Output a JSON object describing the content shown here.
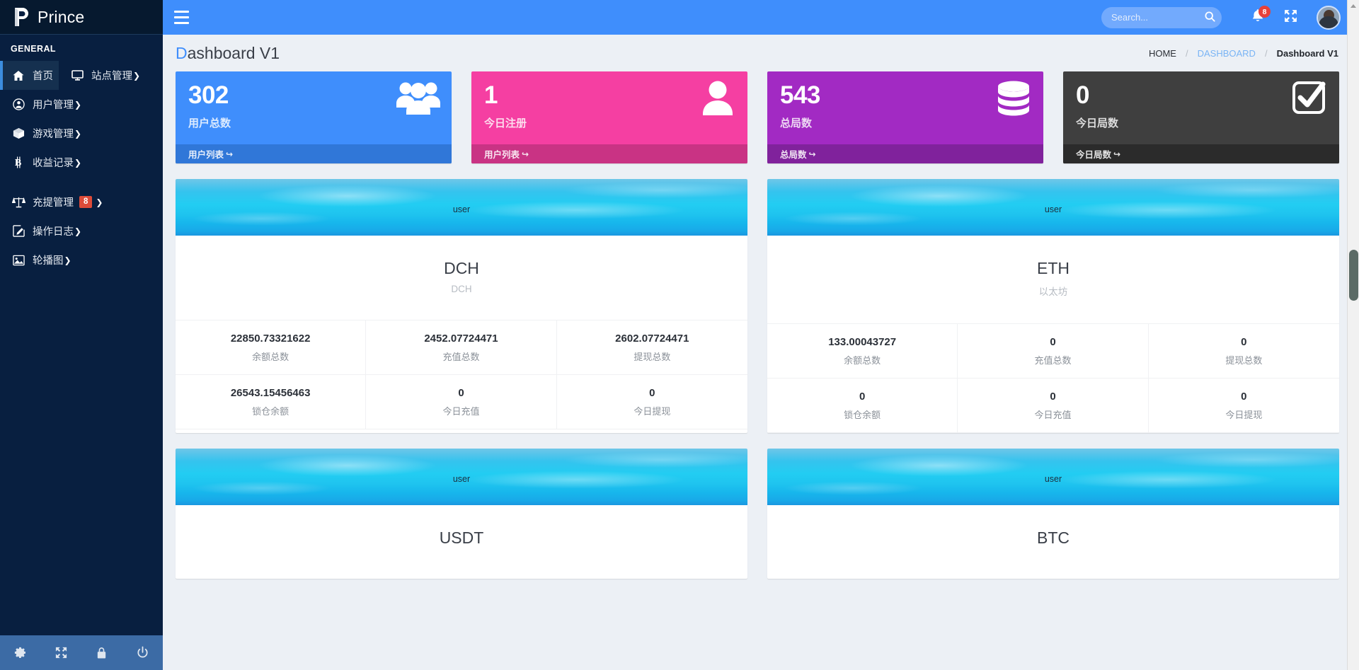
{
  "brand": {
    "name": "Prince",
    "logo_icon": "prince-logo-icon"
  },
  "sidebar": {
    "section_label": "GENERAL",
    "items": [
      {
        "label": "首页",
        "icon": "home-icon",
        "active": true
      },
      {
        "label": "站点管理",
        "icon": "monitor-icon",
        "caret": "❯"
      },
      {
        "label": "用户管理",
        "icon": "user-circle-icon",
        "caret": "❯"
      },
      {
        "label": "游戏管理",
        "icon": "cube-icon",
        "caret": "❯"
      },
      {
        "label": "收益记录",
        "icon": "bitcoin-icon",
        "caret": "❯"
      },
      {
        "label": "充提管理",
        "icon": "balance-scale-icon",
        "badge": "8",
        "caret": "❯"
      },
      {
        "label": "操作日志",
        "icon": "edit-square-icon",
        "caret": "❯"
      },
      {
        "label": "轮播图",
        "icon": "image-icon",
        "caret": "❯"
      }
    ],
    "footer_icons": [
      {
        "name": "gear-icon"
      },
      {
        "name": "expand-arrows-icon"
      },
      {
        "name": "lock-icon"
      },
      {
        "name": "power-off-icon"
      }
    ]
  },
  "topbar": {
    "menu_toggle_icon": "hamburger-icon",
    "search": {
      "placeholder": "Search...",
      "value": "",
      "icon": "search-icon"
    },
    "notifications": {
      "icon": "bell-icon",
      "badge": "8"
    },
    "fullscreen_icon": "expand-arrows-icon",
    "avatar_icon": "user-avatar"
  },
  "page": {
    "title_first": "D",
    "title_rest": "ashboard V1",
    "breadcrumb": [
      {
        "label": "HOME",
        "type": "plain"
      },
      {
        "label": "DASHBOARD",
        "type": "link"
      },
      {
        "label": "Dashboard V1",
        "type": "current"
      }
    ],
    "breadcrumb_sep": "/"
  },
  "stat_cards": [
    {
      "value": "302",
      "label": "用户总数",
      "footer": "用户列表",
      "footer_icon": "↪",
      "icon": "users-group-icon",
      "bg": "#3f8efc",
      "foot_bg": "#3077d8"
    },
    {
      "value": "1",
      "label": "今日注册",
      "footer": "用户列表",
      "footer_icon": "↪",
      "icon": "user-icon",
      "bg": "#f53fa2",
      "foot_bg": "#c93384"
    },
    {
      "value": "543",
      "label": "总局数",
      "footer": "总局数",
      "footer_icon": "↪",
      "icon": "database-icon",
      "bg": "#a22ac3",
      "foot_bg": "#80229c"
    },
    {
      "value": "0",
      "label": "今日局数",
      "footer": "今日局数",
      "footer_icon": "↪",
      "icon": "check-square-icon",
      "bg": "#3f3f3f",
      "foot_bg": "#2b2b2b"
    }
  ],
  "coin_cards": [
    {
      "banner_text": "user",
      "title": "DCH",
      "subtitle": "DCH",
      "cells": [
        {
          "value": "22850.73321622",
          "key": "余额总数"
        },
        {
          "value": "2452.07724471",
          "key": "充值总数"
        },
        {
          "value": "2602.07724471",
          "key": "提现总数"
        },
        {
          "value": "26543.15456463",
          "key": "锁仓余额"
        },
        {
          "value": "0",
          "key": "今日充值"
        },
        {
          "value": "0",
          "key": "今日提现"
        }
      ]
    },
    {
      "banner_text": "user",
      "title": "ETH",
      "subtitle": "以太坊",
      "cells": [
        {
          "value": "133.00043727",
          "key": "余额总数"
        },
        {
          "value": "0",
          "key": "充值总数"
        },
        {
          "value": "0",
          "key": "提现总数"
        },
        {
          "value": "0",
          "key": "锁仓余额"
        },
        {
          "value": "0",
          "key": "今日充值"
        },
        {
          "value": "0",
          "key": "今日提现"
        }
      ]
    },
    {
      "banner_text": "user",
      "title": "USDT",
      "subtitle": "",
      "cells": []
    },
    {
      "banner_text": "user",
      "title": "BTC",
      "subtitle": "",
      "cells": []
    }
  ],
  "colors": {
    "sidebar_bg": "#081f40",
    "header_blue": "#3f8efc",
    "accent": "#3f8efc",
    "badge_red": "#dd4b39",
    "content_bg": "#ecf0f5"
  }
}
